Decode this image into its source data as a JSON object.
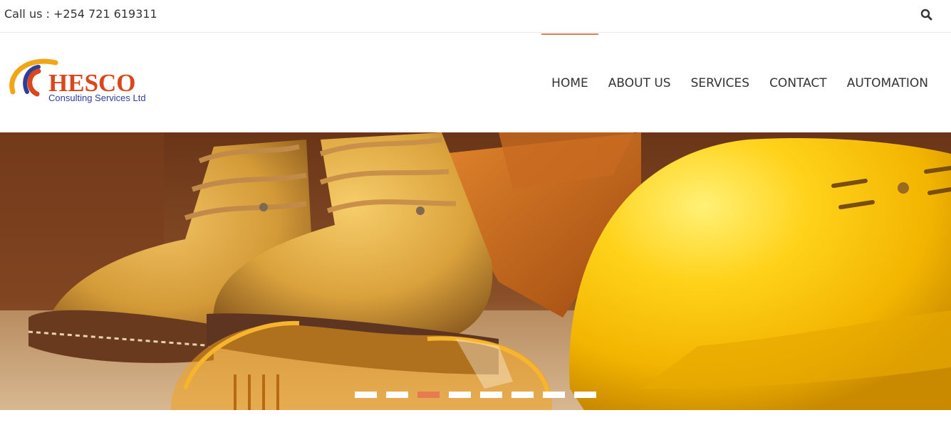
{
  "topbar": {
    "call_text": "Call us : +254 721 619311",
    "search_icon": "search-icon"
  },
  "logo": {
    "brand": "HESCO",
    "tagline": "Consulting Services Ltd"
  },
  "nav": {
    "items": [
      {
        "label": "HOME",
        "active": true
      },
      {
        "label": "ABOUT US",
        "active": false
      },
      {
        "label": "SERVICES",
        "active": false
      },
      {
        "label": "CONTACT",
        "active": false
      },
      {
        "label": "AUTOMATION",
        "active": false
      }
    ]
  },
  "slider": {
    "slide_count": 8,
    "active_index": 2
  },
  "colors": {
    "accent": "#e57b4f",
    "text": "#333333",
    "logo_red": "#d9481c",
    "logo_blue": "#2c3f9a",
    "logo_orange": "#f2a516"
  }
}
